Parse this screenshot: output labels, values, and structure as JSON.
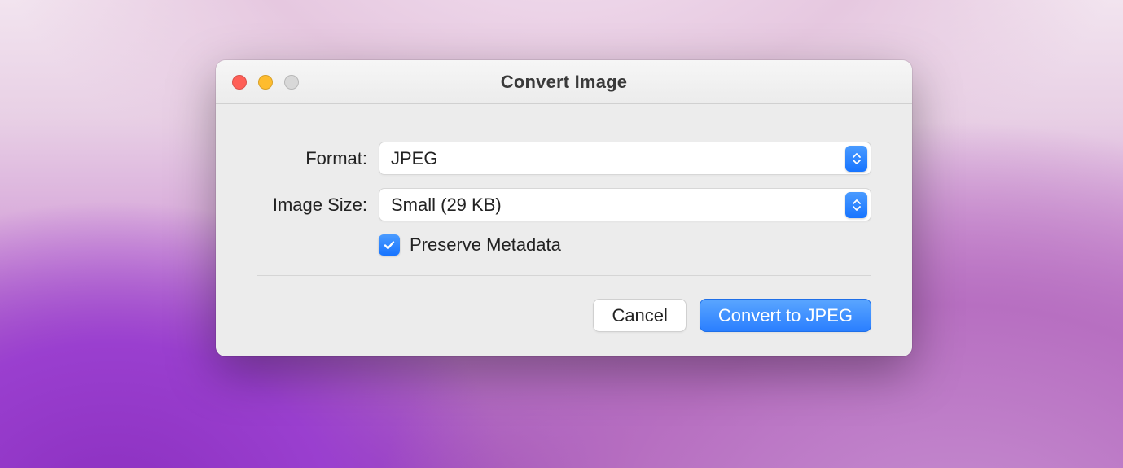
{
  "dialog": {
    "title": "Convert Image",
    "format_label": "Format:",
    "format_value": "JPEG",
    "size_label": "Image Size:",
    "size_value": "Small (29 KB)",
    "preserve_metadata_label": "Preserve Metadata",
    "preserve_metadata_checked": true,
    "cancel_label": "Cancel",
    "confirm_label": "Convert to JPEG"
  }
}
